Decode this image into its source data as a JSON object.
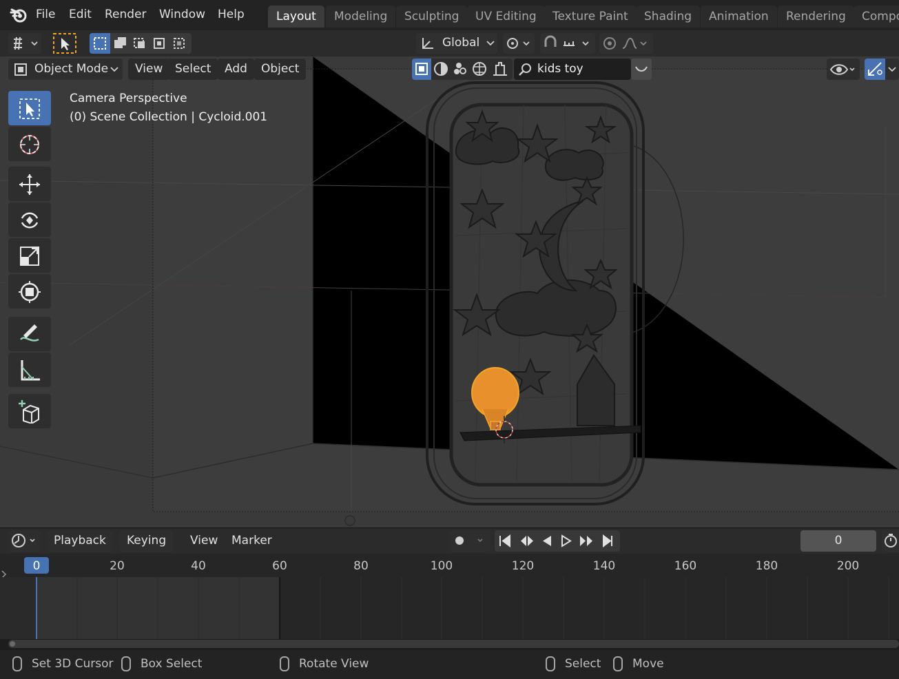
{
  "menu": [
    "File",
    "Edit",
    "Render",
    "Window",
    "Help"
  ],
  "workspaces": [
    "Layout",
    "Modeling",
    "Sculpting",
    "UV Editing",
    "Texture Paint",
    "Shading",
    "Animation",
    "Rendering",
    "Compo"
  ],
  "active_workspace": "Layout",
  "toolbar": {
    "orientation": "Global"
  },
  "viewport": {
    "mode": "Object Mode",
    "menus": [
      "View",
      "Select",
      "Add",
      "Object"
    ],
    "search_value": "kids toy",
    "overlay_title": "Camera Perspective",
    "overlay_subtitle": "(0) Scene Collection | Cycloid.001"
  },
  "tools": [
    "select-box",
    "cursor",
    "move",
    "rotate",
    "scale",
    "transform",
    "annotate",
    "measure",
    "add-cube"
  ],
  "timeline": {
    "menus": [
      "Playback",
      "Keying",
      "View",
      "Marker"
    ],
    "current_frame": "0",
    "ruler": [
      "0",
      "20",
      "40",
      "60",
      "80",
      "100",
      "120",
      "140",
      "160",
      "180",
      "200"
    ]
  },
  "status": {
    "set_cursor": "Set 3D Cursor",
    "box_select": "Box Select",
    "rotate_view": "Rotate View",
    "select": "Select",
    "move": "Move"
  },
  "colors": {
    "accent": "#4772b3",
    "selection": "#f5a623",
    "viewport_bg": "#3c3c3c"
  }
}
